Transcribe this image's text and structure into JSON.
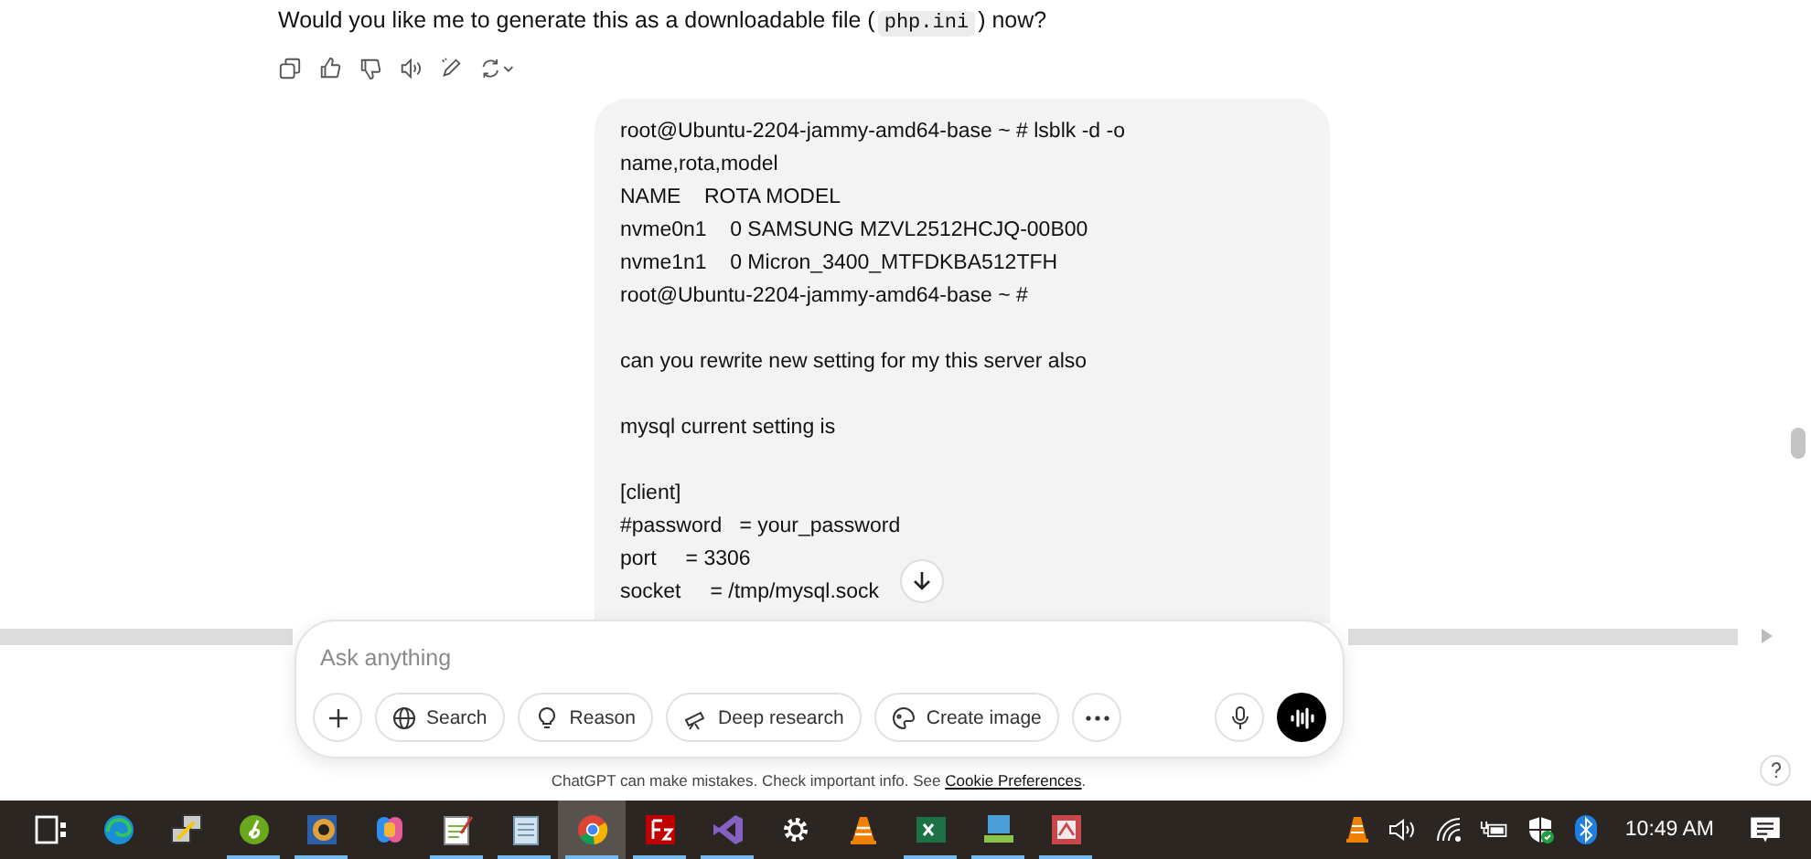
{
  "assistant_message": {
    "text_before": "Would you like me to generate this as a downloadable file (",
    "code": "php.ini",
    "text_after": ") now?"
  },
  "user_message": {
    "blocks": [
      [
        "root@Ubuntu-2204-jammy-amd64-base ~ # lsblk -d -o",
        "name,rota,model",
        "NAME    ROTA MODEL",
        "nvme0n1    0 SAMSUNG MZVL2512HCJQ-00B00",
        "nvme1n1    0 Micron_3400_MTFDKBA512TFH",
        "root@Ubuntu-2204-jammy-amd64-base ~ #"
      ],
      [
        "can you rewrite new setting for my this server also"
      ],
      [
        "mysql current setting is"
      ],
      [
        "[client]",
        "#password   = your_password",
        "port     = 3306",
        "socket     = /tmp/mysql.sock"
      ]
    ]
  },
  "composer": {
    "placeholder": "Ask anything",
    "tools": [
      {
        "label": "Search",
        "kind": "globe"
      },
      {
        "label": "Reason",
        "kind": "bulb"
      },
      {
        "label": "Deep research",
        "kind": "telescope"
      },
      {
        "label": "Create image",
        "kind": "palette"
      }
    ]
  },
  "disclaimer": {
    "text": "ChatGPT can make mistakes. Check important info. See",
    "link": "Cookie Preferences",
    "end": "."
  },
  "taskbar": {
    "apps": [
      {
        "kind": "task_view",
        "running": false,
        "selected": false
      },
      {
        "kind": "edge",
        "running": false,
        "selected": false
      },
      {
        "kind": "putty",
        "running": false,
        "selected": false
      },
      {
        "kind": "green_d",
        "running": true,
        "selected": false
      },
      {
        "kind": "blue_app",
        "running": true,
        "selected": false
      },
      {
        "kind": "copilot",
        "running": false,
        "selected": false
      },
      {
        "kind": "notepadpp",
        "running": true,
        "selected": false
      },
      {
        "kind": "notepad",
        "running": true,
        "selected": false
      },
      {
        "kind": "chrome",
        "running": true,
        "selected": true
      },
      {
        "kind": "filezilla",
        "running": true,
        "selected": false
      },
      {
        "kind": "vs",
        "running": true,
        "selected": false
      },
      {
        "kind": "gear",
        "running": false,
        "selected": false
      },
      {
        "kind": "vlc",
        "running": false,
        "selected": false
      },
      {
        "kind": "excel",
        "running": true,
        "selected": false
      },
      {
        "kind": "network",
        "running": true,
        "selected": false
      },
      {
        "kind": "red_app",
        "running": true,
        "selected": false
      }
    ],
    "time": "10:49 AM"
  }
}
